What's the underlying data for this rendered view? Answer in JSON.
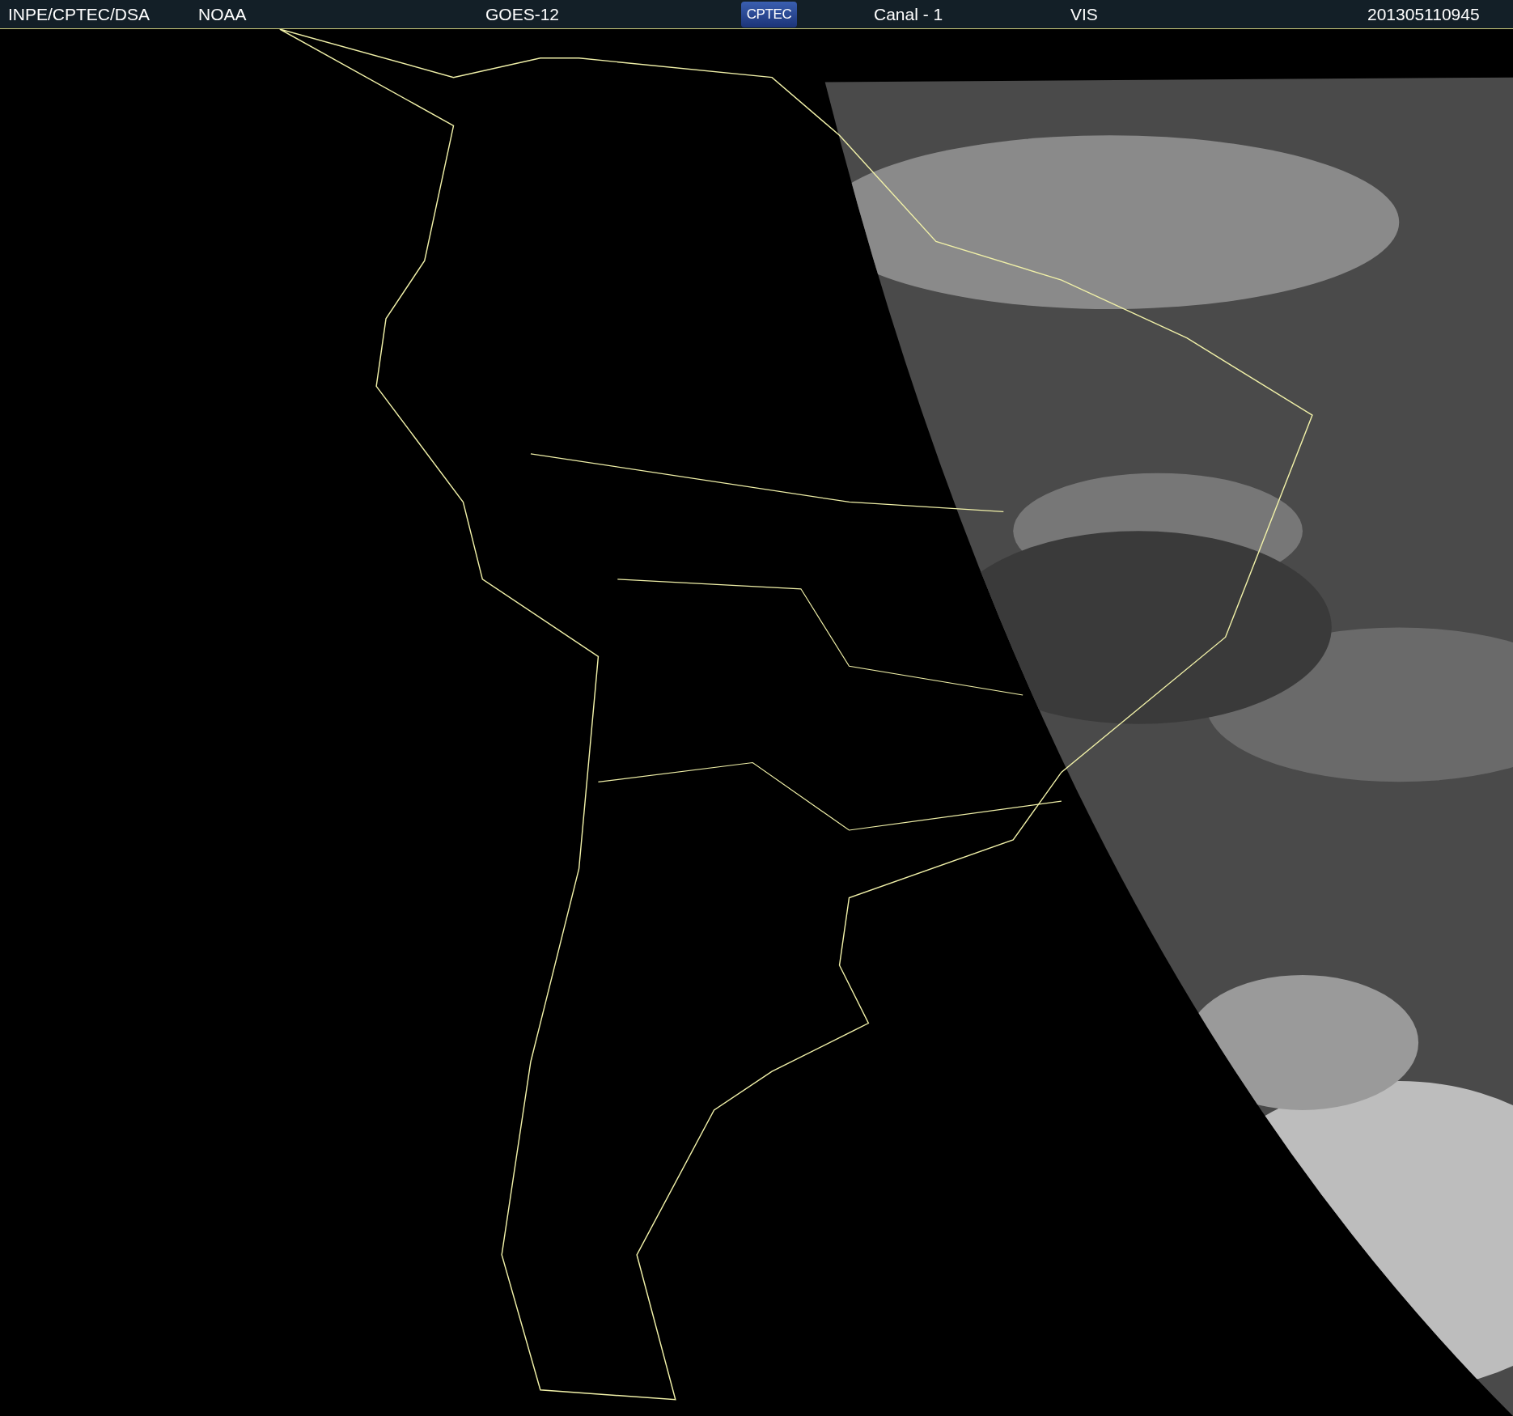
{
  "header": {
    "items": [
      {
        "kind": "text",
        "text": "INPE/CPTEC/DSA"
      },
      {
        "kind": "text",
        "text": "NOAA"
      },
      {
        "kind": "text",
        "text": "GOES-12"
      },
      {
        "kind": "logo",
        "text": "CPTEC"
      },
      {
        "kind": "text",
        "text": "Canal - 1"
      },
      {
        "kind": "text",
        "text": "VIS"
      },
      {
        "kind": "text",
        "text": "201305110945"
      }
    ]
  }
}
